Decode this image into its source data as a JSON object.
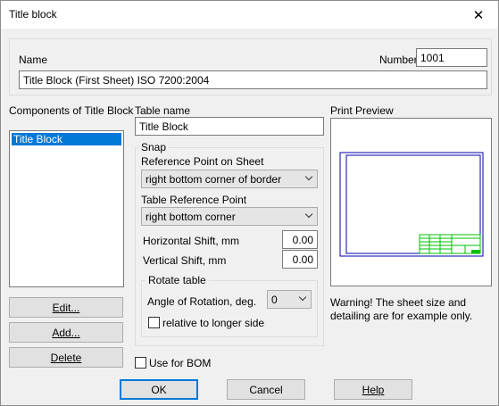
{
  "window": {
    "title": "Title block"
  },
  "name_section": {
    "name_label": "Name",
    "number_label": "Number",
    "number_value": "1001",
    "name_value": "Title Block (First Sheet) ISO 7200:2004"
  },
  "components": {
    "label": "Components of Title Block",
    "items": [
      "Title Block"
    ],
    "edit_label": "Edit...",
    "add_label": "Add...",
    "delete_label": "Delete"
  },
  "table": {
    "name_label": "Table name",
    "name_value": "Title Block"
  },
  "snap": {
    "title": "Snap",
    "ref_sheet_label": "Reference Point on Sheet",
    "ref_sheet_value": "right bottom corner of border",
    "table_ref_label": "Table Reference Point",
    "table_ref_value": "right bottom corner",
    "h_shift_label": "Horizontal Shift, mm",
    "h_shift_value": "0.00",
    "v_shift_label": "Vertical Shift, mm",
    "v_shift_value": "0.00"
  },
  "rotate": {
    "title": "Rotate table",
    "angle_label": "Angle of Rotation, deg.",
    "angle_value": "0",
    "longer_side_label": "relative to longer side"
  },
  "preview": {
    "label": "Print Preview",
    "warning": "Warning! The sheet size and detailing are for example only."
  },
  "bom": {
    "label": "Use for BOM"
  },
  "footer": {
    "ok_label": "OK",
    "cancel_label": "Cancel",
    "help_label": "Help"
  },
  "colors": {
    "accent": "#0078d7",
    "preview_border": "#0000aa",
    "preview_table": "#00c000"
  }
}
